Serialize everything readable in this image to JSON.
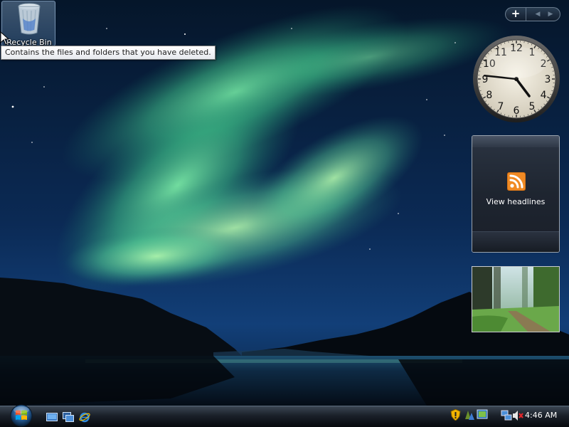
{
  "desktop": {
    "icons": [
      {
        "label": "Recycle Bin",
        "icon": "recycle-bin-icon"
      }
    ],
    "tooltip": "Contains the files and folders that you have deleted."
  },
  "sidebar": {
    "controls": {
      "add_label": "+",
      "prev_label": "◀",
      "next_label": "▶"
    },
    "clock": {
      "numerals": [
        "12",
        "1",
        "2",
        "3",
        "4",
        "5",
        "6",
        "7",
        "8",
        "9",
        "10",
        "11"
      ],
      "hour": 4,
      "minute": 46
    },
    "feed": {
      "link_text": "View headlines",
      "icon": "rss-icon"
    },
    "slideshow": {
      "icon": "forest-photo"
    }
  },
  "taskbar": {
    "start_icon": "windows-orb-icon",
    "quick_launch": [
      "show-desktop-icon",
      "switch-windows-icon",
      "internet-explorer-icon"
    ],
    "tray": {
      "icons": [
        "security-alert-icon",
        "windows-defender-icon",
        "network-icon",
        "network-connection-icon",
        "volume-muted-icon"
      ],
      "clock": "4:46 AM"
    }
  },
  "colors": {
    "aurora": "#46d28a",
    "taskbar": "#1a2029",
    "tooltip_border": "#7a7a7a"
  }
}
